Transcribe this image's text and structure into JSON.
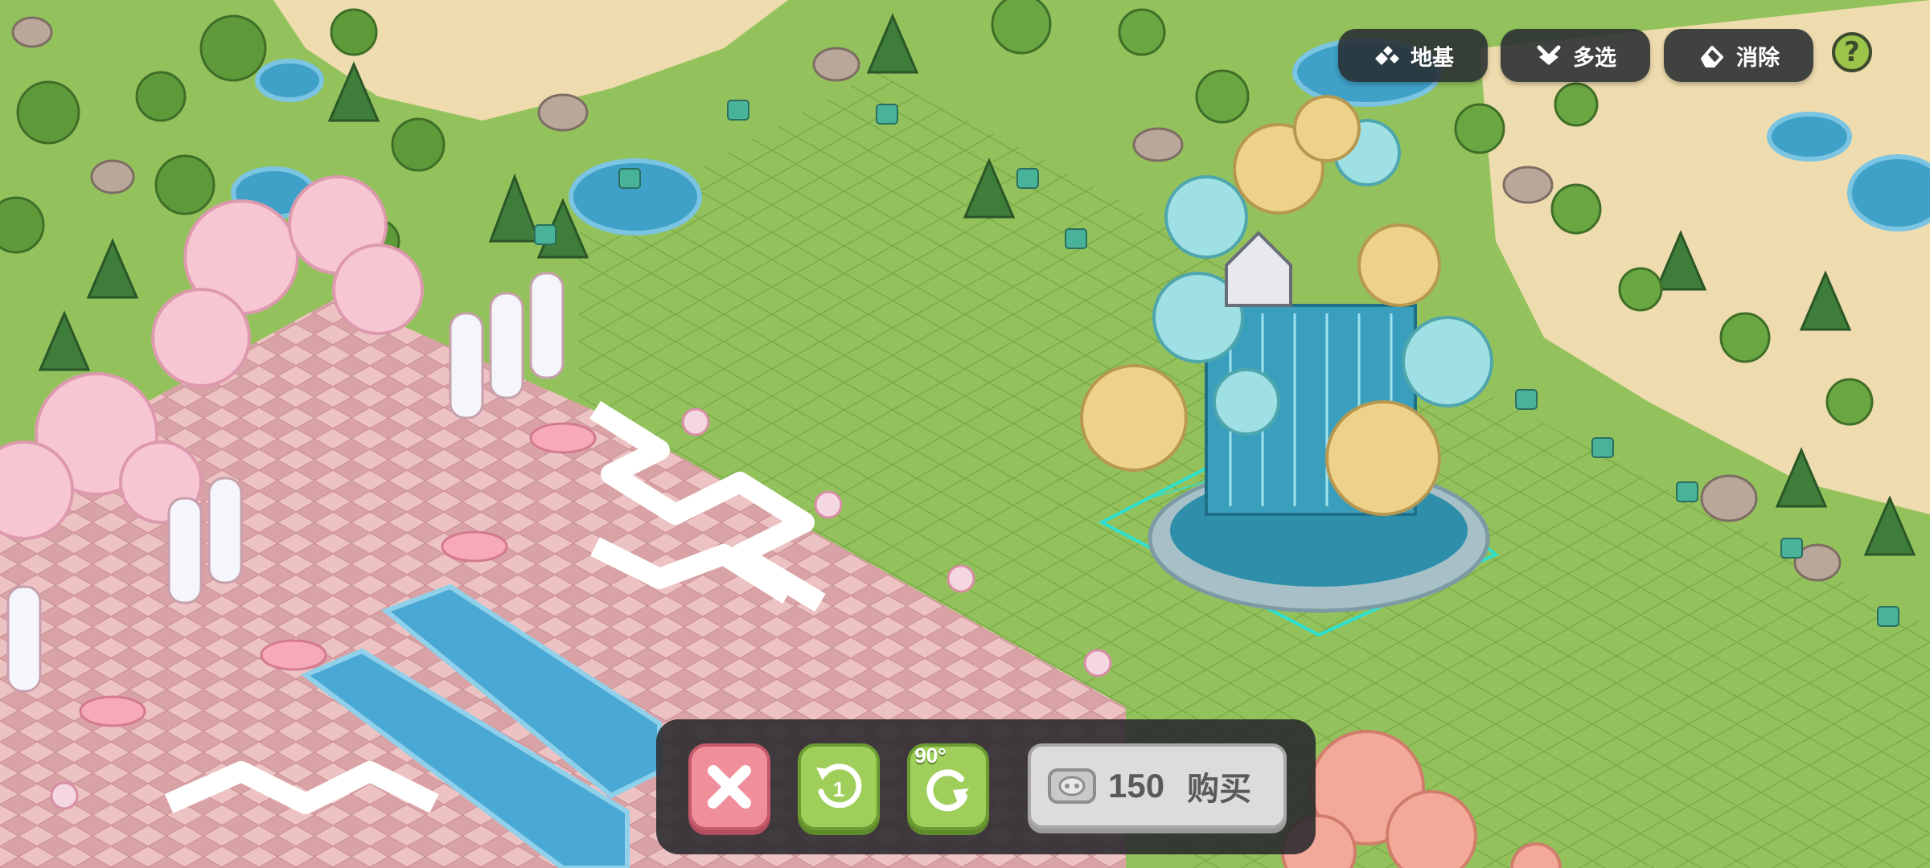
{
  "top_toolbar": {
    "foundation_label": "地基",
    "multiselect_label": "多选",
    "erase_label": "消除",
    "help_label": "?"
  },
  "action_bar": {
    "cancel_icon": "close-icon",
    "rotate_ccw_icon": "rotate-left-icon",
    "rotate_ccw_label": "1",
    "rotate_cw_icon": "rotate-right-icon",
    "rotate_cw_angle": "90°",
    "buy": {
      "currency_icon": "coin-icon",
      "price": "150",
      "label": "购买"
    }
  },
  "colors": {
    "grass": "#8fbf5a",
    "sand": "#eedcae",
    "water": "#3fa0c8",
    "placement_grid": "#2fe0d0",
    "pink_plaza": "#e9b6b8",
    "cancel": "#f08f9c",
    "confirm_green": "#9fcf5a",
    "toolbar_bg": "#2a2c30"
  }
}
